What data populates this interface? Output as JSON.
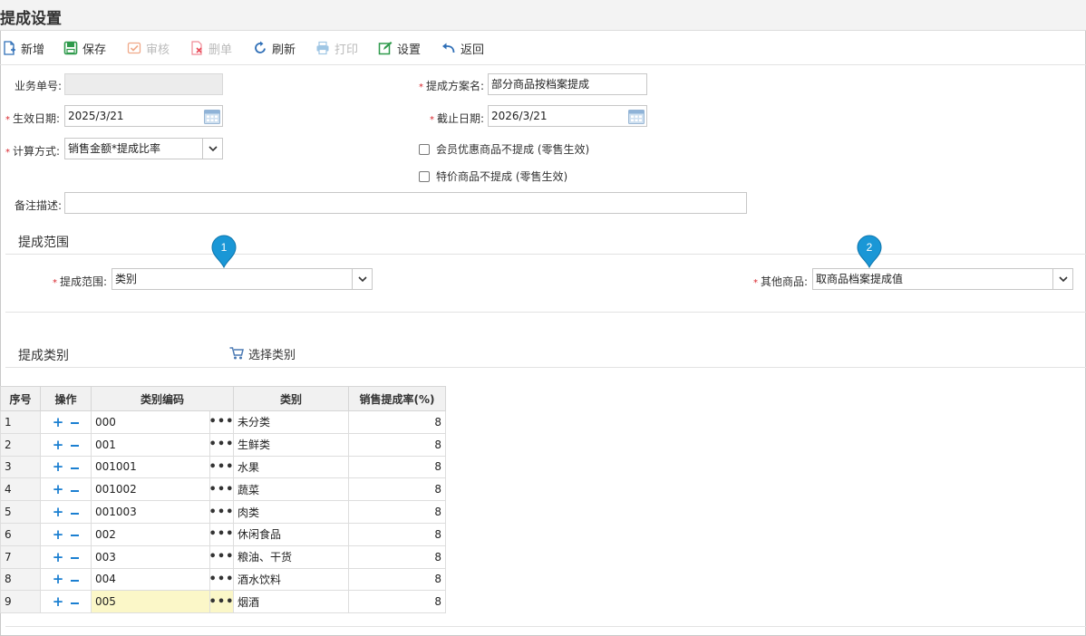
{
  "page": {
    "title": "提成设置"
  },
  "toolbar": {
    "new": "新增",
    "save": "保存",
    "audit": "审核",
    "delete": "删单",
    "refresh": "刷新",
    "print": "打印",
    "settings": "设置",
    "back": "返回"
  },
  "form": {
    "doc_no": {
      "label": "业务单号:",
      "value": ""
    },
    "scheme_name": {
      "label": "提成方案名:",
      "value": "部分商品按档案提成"
    },
    "effective_date": {
      "label": "生效日期:",
      "value": "2025/3/21"
    },
    "end_date": {
      "label": "截止日期:",
      "value": "2026/3/21"
    },
    "calc_method": {
      "label": "计算方式:",
      "value": "销售金额*提成比率"
    },
    "member_discount_check": {
      "label": "会员优惠商品不提成 (零售生效)"
    },
    "special_price_check": {
      "label": "特价商品不提成 (零售生效)"
    },
    "remark": {
      "label": "备注描述:",
      "value": ""
    }
  },
  "range_section": {
    "title": "提成范围",
    "range": {
      "label": "提成范围:",
      "value": "类别"
    },
    "other_goods": {
      "label": "其他商品:",
      "value": "取商品档案提成值"
    },
    "pins": [
      "1",
      "2"
    ]
  },
  "category_section": {
    "title": "提成类别",
    "select_button": "选择类别"
  },
  "grid": {
    "headers": [
      "序号",
      "操作",
      "类别编码",
      "类别",
      "销售提成率(%)"
    ],
    "rows": [
      {
        "seq": "1",
        "code": "000",
        "name": "未分类",
        "rate": "8"
      },
      {
        "seq": "2",
        "code": "001",
        "name": "生鲜类",
        "rate": "8"
      },
      {
        "seq": "3",
        "code": "001001",
        "name": "水果",
        "rate": "8"
      },
      {
        "seq": "4",
        "code": "001002",
        "name": "蔬菜",
        "rate": "8"
      },
      {
        "seq": "5",
        "code": "001003",
        "name": "肉类",
        "rate": "8"
      },
      {
        "seq": "6",
        "code": "002",
        "name": "休闲食品",
        "rate": "8"
      },
      {
        "seq": "7",
        "code": "003",
        "name": "粮油、干货",
        "rate": "8"
      },
      {
        "seq": "8",
        "code": "004",
        "name": "酒水饮料",
        "rate": "8"
      },
      {
        "seq": "9",
        "code": "005",
        "name": "烟酒",
        "rate": "8"
      }
    ],
    "highlight_row": 8,
    "op_plus": "+",
    "dots": "•••"
  },
  "colors": {
    "accent": "#1b7fd1",
    "pin": "#1a97d6",
    "required": "#d9272e",
    "highlight": "#fbf7c8"
  }
}
